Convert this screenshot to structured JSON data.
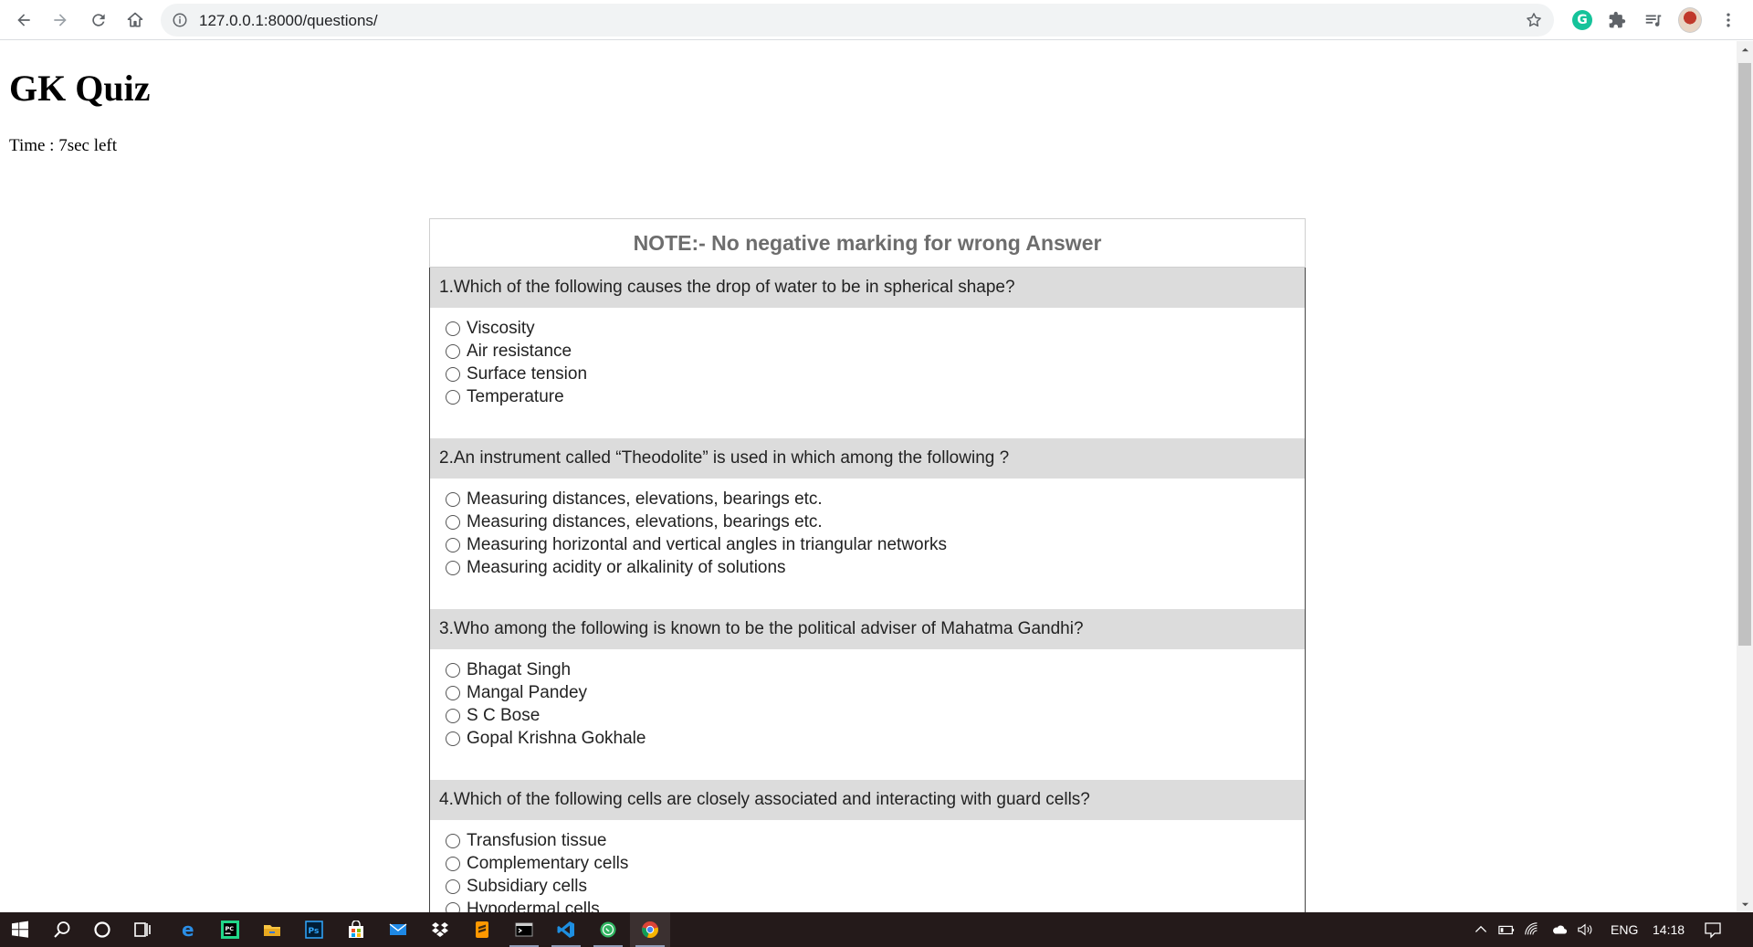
{
  "browser": {
    "url": "127.0.0.1:8000/questions/",
    "icons": [
      "back-icon",
      "forward-icon",
      "reload-icon",
      "home-icon",
      "info-icon",
      "star-icon",
      "grammarly-icon",
      "extensions-icon",
      "media-icon",
      "profile-avatar",
      "menu-icon"
    ],
    "grammarly_letter": "G"
  },
  "page": {
    "title": "GK Quiz",
    "timer": "Time : 7sec left",
    "note": "NOTE:- No negative marking for wrong Answer",
    "questions": [
      {
        "text": "1.Which of the following causes the drop of water to be in spherical shape?",
        "options": [
          "Viscosity",
          "Air resistance",
          "Surface tension",
          "Temperature"
        ]
      },
      {
        "text": "2.An instrument called “Theodolite” is used in which among the following ?",
        "options": [
          "Measuring distances, elevations, bearings etc.",
          "Measuring distances, elevations, bearings etc.",
          "Measuring horizontal and vertical angles in triangular networks",
          "Measuring acidity or alkalinity of solutions"
        ]
      },
      {
        "text": "3.Who among the following is known to be the political adviser of Mahatma Gandhi?",
        "options": [
          "Bhagat Singh",
          "Mangal Pandey",
          "S C Bose",
          "Gopal Krishna Gokhale"
        ]
      },
      {
        "text": "4.Which of the following cells are closely associated and interacting with guard cells?",
        "options": [
          "Transfusion tissue",
          "Complementary cells",
          "Subsidiary cells",
          "Hypodermal cells"
        ]
      }
    ]
  },
  "taskbar": {
    "apps": [
      "windows-start",
      "search",
      "cortana",
      "task-view",
      "edge",
      "pycharm",
      "file-explorer",
      "photoshop",
      "store",
      "mail",
      "dropbox",
      "sublime-text",
      "terminal",
      "vs-code",
      "whatsapp",
      "chrome"
    ],
    "photoshop_label": "Ps",
    "pycharm_label": "PC",
    "language": "ENG",
    "time": "14:18"
  },
  "colors": {
    "question_header_bg": "#dcdcdc",
    "note_text": "#6d6d6d",
    "taskbar_bg": "#241a1a"
  }
}
